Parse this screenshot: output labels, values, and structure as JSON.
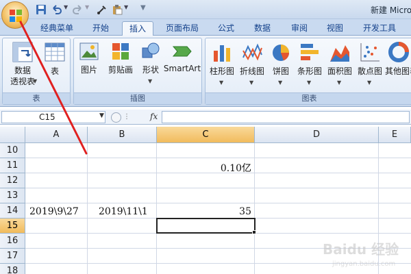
{
  "window": {
    "title": "新建 Micro"
  },
  "tabs": [
    "经典菜单",
    "开始",
    "插入",
    "页面布局",
    "公式",
    "数据",
    "审阅",
    "视图",
    "开发工具"
  ],
  "active_tab": "插入",
  "ribbon": {
    "groups": [
      {
        "label": "表",
        "buttons": [
          {
            "label": "数据\n透视表",
            "icon": "pivot-table-icon"
          },
          {
            "label": "表",
            "icon": "table-icon"
          }
        ]
      },
      {
        "label": "插图",
        "buttons": [
          {
            "label": "图片",
            "icon": "picture-icon"
          },
          {
            "label": "剪贴画",
            "icon": "clipart-icon"
          },
          {
            "label": "形状",
            "icon": "shapes-icon"
          },
          {
            "label": "SmartArt",
            "icon": "smartart-icon"
          }
        ]
      },
      {
        "label": "图表",
        "buttons": [
          {
            "label": "柱形图",
            "icon": "column-chart-icon"
          },
          {
            "label": "折线图",
            "icon": "line-chart-icon"
          },
          {
            "label": "饼图",
            "icon": "pie-chart-icon"
          },
          {
            "label": "条形图",
            "icon": "bar-chart-icon"
          },
          {
            "label": "面积图",
            "icon": "area-chart-icon"
          },
          {
            "label": "散点图",
            "icon": "scatter-chart-icon"
          },
          {
            "label": "其他图表",
            "icon": "other-charts-icon"
          }
        ]
      }
    ]
  },
  "formula_bar": {
    "name_box": "C15",
    "fx_label": "fx",
    "formula": ""
  },
  "grid": {
    "columns": [
      "A",
      "B",
      "C",
      "D",
      "E"
    ],
    "selected_column": "C",
    "rows": [
      10,
      11,
      12,
      13,
      14,
      15,
      16,
      17,
      18
    ],
    "selected_row": 15,
    "cells": [
      {
        "ref": "C11",
        "value": "0.10亿"
      },
      {
        "ref": "A14",
        "value": "2019\\9\\27"
      },
      {
        "ref": "B14",
        "value": "2019\\11\\1"
      },
      {
        "ref": "C14",
        "value": "35"
      }
    ],
    "selected_cell": "C15"
  },
  "annotation": {
    "color": "#e02020"
  },
  "watermark": {
    "line1": "Baidu 经验",
    "line2": "jingyan.baidu.com"
  },
  "colors": {
    "accent": "#f1bb5c",
    "ribbon": "#dae6f4",
    "header": "#dbe4f1"
  }
}
